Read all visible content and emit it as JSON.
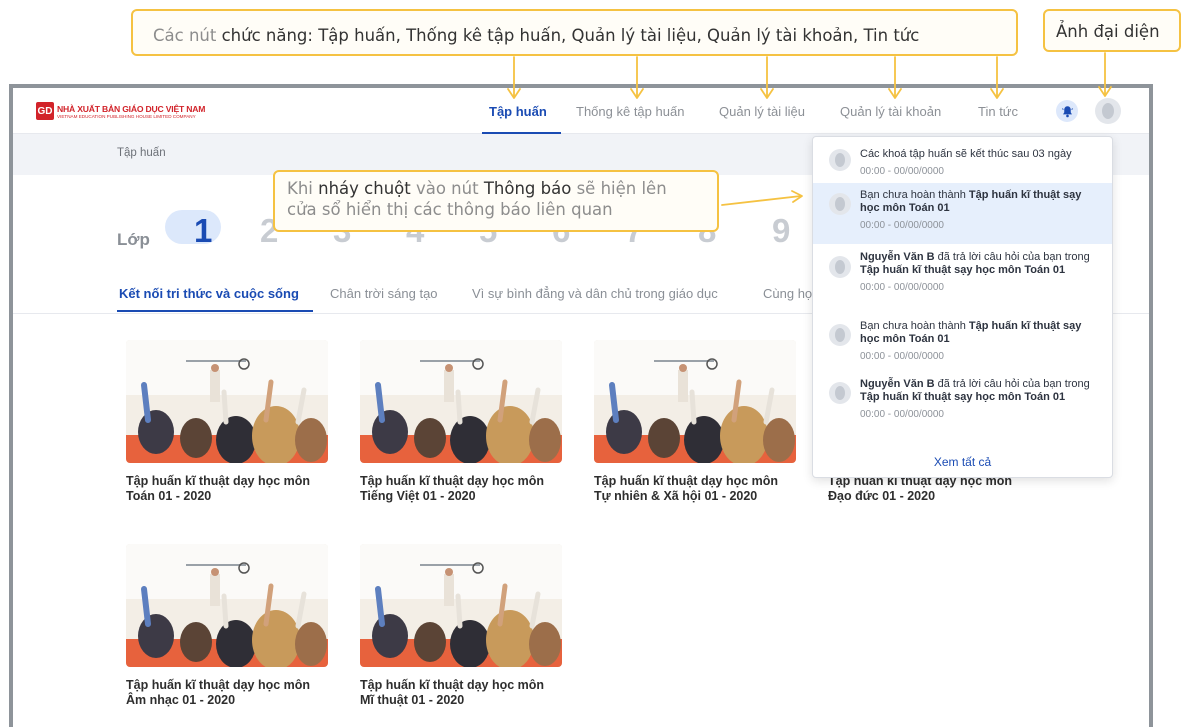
{
  "annotations": {
    "functions": {
      "muted_prefix": "Các nút",
      "text": "chức năng: Tập huấn, Thống kê tập huấn, Quản lý tài liệu, Quản lý tài khoản, Tin tức"
    },
    "avatar": "Ảnh đại diện",
    "notify": {
      "p1": "Khi",
      "p2": "nháy chuột",
      "p3": "vào nút",
      "p4": "Thông báo",
      "p5": "sẽ hiện lên",
      "line2": "cửa sổ hiển thị các thông báo liên quan"
    }
  },
  "logo": {
    "mark": "GD",
    "name": "NHÀ XUẤT BẢN GIÁO DỤC VIỆT NAM",
    "sub": "VIETNAM EDUCATION PUBLISHING HOUSE LIMITED COMPANY"
  },
  "nav": {
    "items": [
      "Tập huấn",
      "Thống kê tập huấn",
      "Quản lý tài liệu",
      "Quản lý tài khoản",
      "Tin tức"
    ],
    "active": "Tập huấn"
  },
  "breadcrumb": "Tập huấn",
  "grades": {
    "label": "Lớp",
    "values": [
      "1",
      "2",
      "3",
      "4",
      "5",
      "6",
      "7",
      "8",
      "9"
    ],
    "active": "1"
  },
  "publishers": {
    "tabs": [
      "Kết nối tri thức và cuộc sống",
      "Chân trời sáng tạo",
      "Vì sự bình đẳng và dân chủ trong giáo dục",
      "Cùng học"
    ],
    "active": "Kết nối tri thức và cuộc sống"
  },
  "cards": [
    {
      "line1": "Tập huấn kĩ thuật dạy học môn",
      "line2": "Toán 01 - 2020"
    },
    {
      "line1": "Tập huấn kĩ thuật dạy học môn",
      "line2": "Tiếng Việt 01 - 2020"
    },
    {
      "line1": "Tập huấn kĩ thuật dạy học môn",
      "line2": "Tự nhiên & Xã hội 01 - 2020"
    },
    {
      "line1": "Tập huấn kĩ thuật dạy học môn",
      "line2": "Đạo đức 01 - 2020"
    },
    {
      "line1": "Tập huấn kĩ thuật dạy học môn",
      "line2": "Âm nhạc 01 - 2020"
    },
    {
      "line1": "Tập huấn kĩ thuật dạy học môn",
      "line2": "Mĩ thuật 01 - 2020"
    }
  ],
  "notifications": {
    "items": [
      {
        "pre": "Các khoá tập huấn sẽ kết thúc sau 03 ngày",
        "bold": "",
        "post": "",
        "time": "00:00 - 00/00/0000"
      },
      {
        "pre": "Bạn chưa hoàn thành ",
        "bold": "Tập huấn kĩ thuật sạy học môn Toán 01",
        "post": "",
        "time": "00:00 - 00/00/0000"
      },
      {
        "pre": "",
        "bold": "Nguyễn Văn B",
        "post": " đã trả lời câu hỏi của bạn trong ",
        "bold2": "Tập huấn kĩ thuật sạy học môn Toán 01",
        "time": "00:00 - 00/00/0000"
      },
      {
        "pre": "Bạn chưa hoàn thành ",
        "bold": "Tập huấn kĩ thuật sạy học môn Toán 01",
        "post": "",
        "time": "00:00 - 00/00/0000"
      },
      {
        "pre": "",
        "bold": "Nguyễn Văn B",
        "post": " đã trả lời câu hỏi của bạn trong ",
        "bold2": "Tập huấn kĩ thuật sạy học môn Toán 01",
        "time": "00:00 - 00/00/0000"
      }
    ],
    "see_all": "Xem tất cả"
  },
  "icons": {
    "bell": "bell-icon",
    "avatar": "user-avatar-icon"
  },
  "colors": {
    "accent": "#1a4bb3",
    "callout_border": "#f5c242",
    "highlight": "#e6effc"
  }
}
